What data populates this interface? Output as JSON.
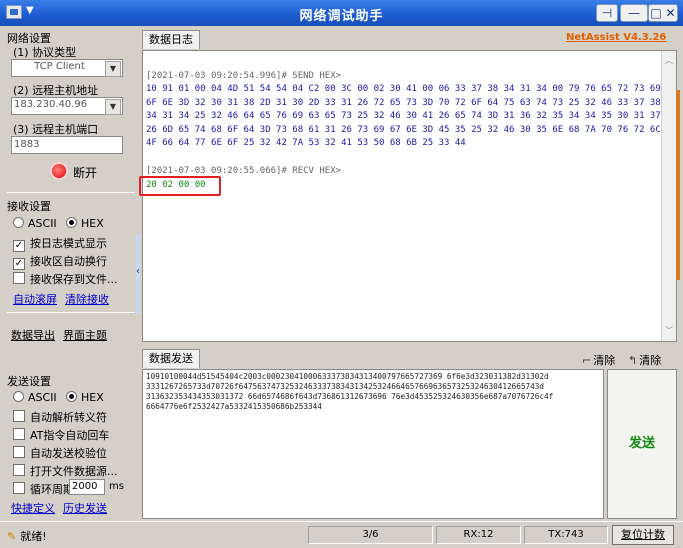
{
  "window": {
    "title": "网络调试助手",
    "menu_caret": "▼",
    "pin": "⊣",
    "min": "—",
    "close": "□ ✕"
  },
  "net_settings": {
    "group_title": "网络设置",
    "protocol_label": "(1) 协议类型",
    "protocol_value": "TCP Client",
    "host_label": "(2) 远程主机地址",
    "host_value": "183.230.40.96",
    "port_label": "(3) 远程主机端口",
    "port_value": "1883",
    "connect_button": "断开"
  },
  "recv_settings": {
    "group_title": "接收设置",
    "ascii": "ASCII",
    "hex": "HEX",
    "log_mode": "按日志模式显示",
    "auto_wrap": "接收区自动换行",
    "save_to_file": "接收保存到文件...",
    "auto_scroll": "自动滚屏",
    "clear_recv": "清除接收"
  },
  "tools": {
    "export": "数据导出",
    "theme": "界面主题"
  },
  "send_settings": {
    "group_title": "发送设置",
    "ascii": "ASCII",
    "hex": "HEX",
    "auto_escape": "自动解析转义符",
    "at_crlf": "AT指令自动回车",
    "auto_checksum": "自动发送校验位",
    "open_file": "打开文件数据源...",
    "cycle_label": "循环周期",
    "cycle_value": "2000",
    "cycle_unit": "ms",
    "shortcut": "快捷定义",
    "history": "历史发送"
  },
  "log": {
    "tab": "数据日志",
    "brand": "NetAssist V4.3.26",
    "send_header": "[2021-07-03 09:20:54.996]# SEND HEX>",
    "send_lines": [
      "10 91 01 00 04 4D 51 54 54 04 C2 00 3C 00 02 30 41 00 06 33 37 38 34 31 34 00 79 76 65 72 73 69",
      "6F 6E 3D 32 30 31 38 2D 31 30 2D 33 31 26 72 65 73 3D 70 72 6F 64 75 63 74 73 25 32 46 33 37 38",
      "34 31 34 25 32 46 64 65 76 69 63 65 73 25 32 46 30 41 26 65 74 3D 31 36 32 35 34 34 35 30 31 37",
      "26 6D 65 74 68 6F 64 3D 73 68 61 31 26 73 69 67 6E 3D 45 35 25 32 46 30 35 6E 68 7A 70 76 72 6C",
      "4F 66 64 77 6E 6F 25 32 42 7A 53 32 41 53 50 68 6B 25 33 44"
    ],
    "recv_header": "[2021-07-03 09:20:55.066]# RECV HEX>",
    "recv_line": "20 02 00 00"
  },
  "send": {
    "tab": "数据发送",
    "clear_label": "清除",
    "clear2_label": "清除",
    "lines": [
      "10910100044d51545404c2003c00023041000633373834313400797665727369 6f6e3d323031382d31302d",
      "3331267265733d70726f64756374732532463337383431342532466465766963657325324630412665743d",
      "313632353434353031372 66d6574686f643d736861312673696 76e3d453525324630356e687a7076726c4f",
      "6664776e6f2532427a5332415350686b253344"
    ],
    "send_button": "发送"
  },
  "status": {
    "ready": "就绪!",
    "count": "3/6",
    "rx": "RX:12",
    "tx": "TX:743",
    "reset": "复位计数"
  }
}
